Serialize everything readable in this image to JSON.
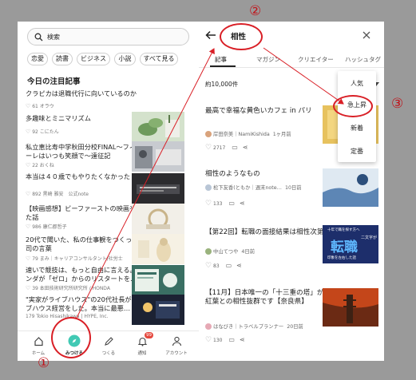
{
  "left": {
    "search_placeholder": "検索",
    "chips": [
      "恋愛",
      "読書",
      "ビジネス",
      "小説",
      "すべて見る"
    ],
    "section_title": "今日の注目記事",
    "articles": [
      {
        "title": "クラピカは退職代行に向いているのか",
        "meta": "61 オラウ"
      },
      {
        "title": "多趣味とミニマリズム",
        "meta": "92 こにたん"
      },
      {
        "title": "私立恵比寿中学秋田分校FINAL～フィナーレはいつも笑顔で～遠征記",
        "meta": "22 おくね"
      },
      {
        "title": "本当は４０歳でもやりたくなかった",
        "meta": "892 黒崎 雅安　公式note"
      },
      {
        "title": "【映画感想】ビーファーストの映画を観た話",
        "meta": "986 康仁郡哲子"
      },
      {
        "title": "20代で聞いた、私の仕事観をつくった上司の言葉",
        "meta": "79 まみ｜キャリアコンサルタント/社労士"
      },
      {
        "title": "速いで競技は、もっと自由に言える。ホンダが「ゼロ」からのリスタートを…",
        "meta": "39 本田技術研究所研究所 / HONDA"
      },
      {
        "title": "\"実家がライブハウス\"の20代社長がライブハウス経営をした。本当に最悪…",
        "meta": "179 Tokio Hisashikawa | HYPE, Inc."
      }
    ],
    "nav": [
      {
        "label": "ホーム"
      },
      {
        "label": "みつける"
      },
      {
        "label": "つくる"
      },
      {
        "label": "通知",
        "badge": "99"
      },
      {
        "label": "アカウント"
      }
    ]
  },
  "right": {
    "query": "相性",
    "tabs": [
      "記事",
      "マガジン",
      "クリエイター",
      "ハッシュタグ"
    ],
    "result_count": "約10,000件",
    "sort_menu": [
      "人気",
      "急上昇",
      "新着",
      "定番"
    ],
    "results": [
      {
        "title": "最高で幸福な黄色いカフェ in パリ",
        "author": "岸田奈美｜NamiKishida",
        "time": "1ヶ月前",
        "likes": "2717"
      },
      {
        "title": "相性のようなもの",
        "author": "松下友香(ともか｜週末note…",
        "time": "10日前",
        "likes": "133"
      },
      {
        "title": "【第22回】転職の面接結果は相性次第",
        "author": "中山てつや",
        "time": "4日前",
        "likes": "83"
      },
      {
        "title": "【11月】日本唯一の「十三重の塔」が紅葉との相性抜群です【奈良県】",
        "author": "はなびき｜トラベルプランナー",
        "time": "20日前",
        "likes": "130"
      }
    ],
    "thumb3_title": "転職",
    "thumb3_sub1": "十年で職を探す方へ",
    "thumb3_sub2": "二文字が",
    "thumb3_sub3": "印象を左右した話"
  },
  "annotations": {
    "one": "①",
    "two": "②",
    "three": "③"
  },
  "colors": {
    "accent": "#41c9b4",
    "annotation_red": "#d91f26",
    "badge": "#e5483d"
  }
}
